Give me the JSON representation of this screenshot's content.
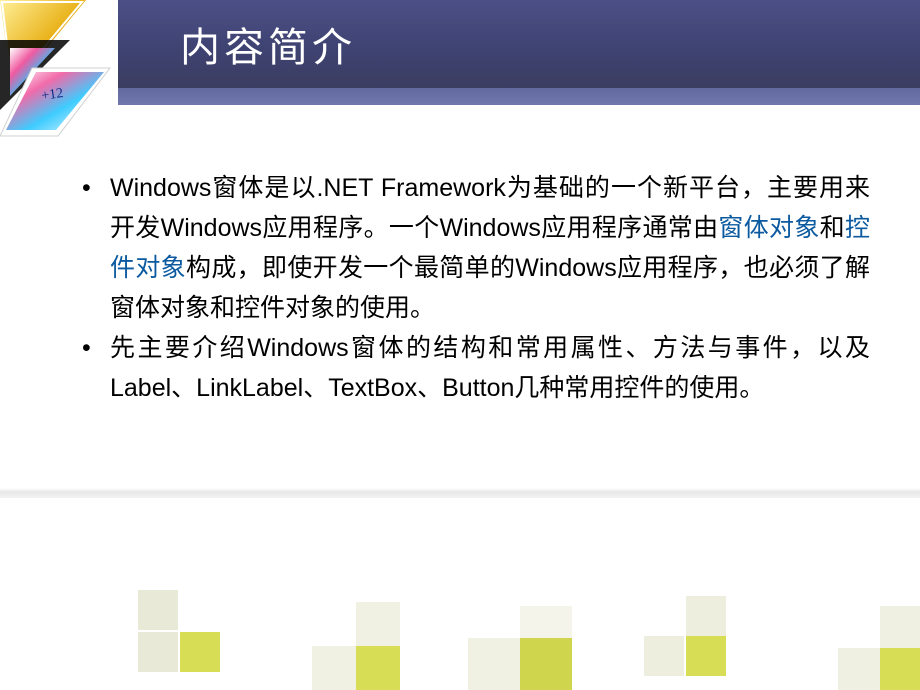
{
  "title": "内容简介",
  "bullets": [
    {
      "segments": [
        {
          "t": "Windows窗体是以.NET Framework为基础的一个新平台，主要用来开发Windows应用程序。一个Windows应用程序通常由",
          "hl": false
        },
        {
          "t": "窗体对象",
          "hl": true
        },
        {
          "t": "和",
          "hl": false
        },
        {
          "t": "控件对象",
          "hl": true
        },
        {
          "t": "构成，即使开发一个最简单的Windows应用程序，也必须了解窗体对象和控件对象的使用。",
          "hl": false
        }
      ]
    },
    {
      "segments": [
        {
          "t": "先主要介绍Windows窗体的结构和常用属性、方法与事件，以及Label、LinkLabel、TextBox、Button几种常用控件的使用。",
          "hl": false
        }
      ]
    }
  ],
  "decor": {
    "corner_label": "decorative-gold-bars-graphic",
    "footer_label": "decorative-pixel-squares"
  }
}
